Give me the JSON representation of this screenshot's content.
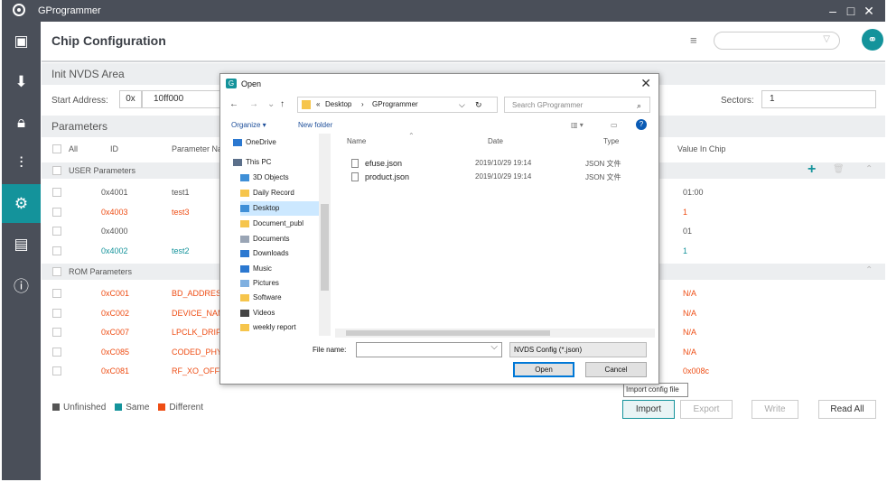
{
  "app": {
    "title": "GProgrammer",
    "minimize": "–",
    "maximize": "□",
    "close": "✕"
  },
  "sidebar": {
    "icons": [
      "chip-icon",
      "download-icon",
      "lock-icon",
      "tools-icon",
      "chip-config-icon",
      "clipboard-icon",
      "info-icon"
    ]
  },
  "header": {
    "title": "Chip Configuration",
    "search_placeholder": ""
  },
  "init_nvds": {
    "title": "Init NVDS Area",
    "start_address_label": "Start Address:",
    "prefix": "0x",
    "address": "10ff000",
    "sectors_label": "Sectors:",
    "sectors": "1"
  },
  "parameters": {
    "title": "Parameters",
    "columns": {
      "all": "All",
      "id": "ID",
      "name": "Parameter Na",
      "value": "Value In Chip"
    },
    "user_group": "USER Parameters",
    "rom_group": "ROM Parameters",
    "user_rows": [
      {
        "id": "0x4001",
        "name": "test1",
        "value": "01:00",
        "status": "grey"
      },
      {
        "id": "0x4003",
        "name": "test3",
        "value": "1",
        "status": "orange"
      },
      {
        "id": "0x4000",
        "name": "",
        "value": "01",
        "status": "grey"
      },
      {
        "id": "0x4002",
        "name": "test2",
        "value": "1",
        "status": "teal"
      }
    ],
    "rom_rows": [
      {
        "id": "0xC001",
        "name": "BD_ADDRESS",
        "value": "N/A",
        "status": "orange"
      },
      {
        "id": "0xC002",
        "name": "DEVICE_NAM",
        "value": "N/A",
        "status": "orange"
      },
      {
        "id": "0xC007",
        "name": "LPCLK_DRIFT",
        "value": "N/A",
        "status": "orange"
      },
      {
        "id": "0xC085",
        "name": "CODED_PHY_",
        "value": "N/A",
        "status": "orange"
      },
      {
        "id": "0xC081",
        "name": "RF_XO_OFFSE",
        "value": "0x008c",
        "status": "orange"
      }
    ]
  },
  "legend": {
    "unfinished": "Unfinished",
    "same": "Same",
    "different": "Different"
  },
  "buttons": {
    "import": "Import",
    "export": "Export",
    "write": "Write",
    "read_all": "Read All"
  },
  "tooltip": "Import config file",
  "dialog": {
    "title": "Open",
    "path": {
      "prefix": "«",
      "seg1": "Desktop",
      "sep": "›",
      "seg2": "GProgrammer"
    },
    "search_placeholder": "Search GProgrammer",
    "organize": "Organize ▾",
    "new_folder": "New folder",
    "tree": [
      "OneDrive",
      "This PC",
      "3D Objects",
      "Daily Record",
      "Desktop",
      "Document_publ",
      "Documents",
      "Downloads",
      "Music",
      "Pictures",
      "Software",
      "Videos",
      "weekly report"
    ],
    "columns": {
      "name": "Name",
      "date": "Date",
      "type": "Type"
    },
    "files": [
      {
        "name": "efuse.json",
        "date": "2019/10/29 19:14",
        "type": "JSON 文件"
      },
      {
        "name": "product.json",
        "date": "2019/10/29 19:14",
        "type": "JSON 文件"
      }
    ],
    "filename_label": "File name:",
    "filename_value": "",
    "filetype": "NVDS Config (*.json)",
    "open": "Open",
    "cancel": "Cancel"
  },
  "colors": {
    "teal": "#14939b",
    "orange": "#ee4d14",
    "sidebar": "#4a4f59",
    "unfinished": "#555555"
  }
}
